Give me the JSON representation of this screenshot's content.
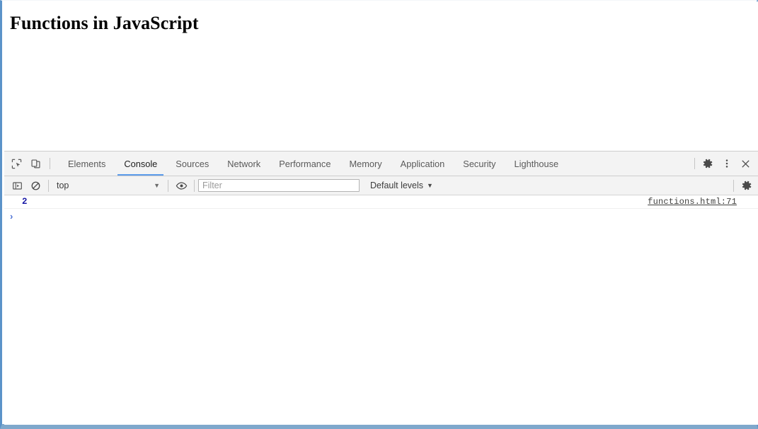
{
  "page": {
    "title": "Functions in JavaScript"
  },
  "devtools": {
    "left_actions": [
      {
        "name": "inspect-element-icon",
        "label": "Inspect element"
      },
      {
        "name": "device-toolbar-icon",
        "label": "Toggle device toolbar"
      }
    ],
    "tabs": [
      {
        "label": "Elements",
        "active": false
      },
      {
        "label": "Console",
        "active": true
      },
      {
        "label": "Sources",
        "active": false
      },
      {
        "label": "Network",
        "active": false
      },
      {
        "label": "Performance",
        "active": false
      },
      {
        "label": "Memory",
        "active": false
      },
      {
        "label": "Application",
        "active": false
      },
      {
        "label": "Security",
        "active": false
      },
      {
        "label": "Lighthouse",
        "active": false
      }
    ],
    "right_actions": [
      {
        "name": "settings-gear-icon",
        "label": "Settings"
      },
      {
        "name": "more-options-icon",
        "label": "Customize and control DevTools"
      },
      {
        "name": "close-devtools-icon",
        "label": "Close DevTools"
      }
    ],
    "accent_color": "#5b9bea",
    "frame_color": "#5b93c9",
    "toolbar_background": "#f3f3f3"
  },
  "console": {
    "toolbar": {
      "sidebar_toggle": "Show console sidebar",
      "clear_console": "Clear console",
      "context": "top",
      "context_caret": "▼",
      "live_expression": "Create live expression",
      "filter_placeholder": "Filter",
      "filter_value": "",
      "levels_label": "Default levels",
      "levels_caret": "▼",
      "settings": "Console settings"
    },
    "messages": [
      {
        "value": "2",
        "value_color": "#1a1aa6",
        "source": "functions.html:71"
      }
    ],
    "prompt": {
      "chevron": "›",
      "value": ""
    }
  }
}
